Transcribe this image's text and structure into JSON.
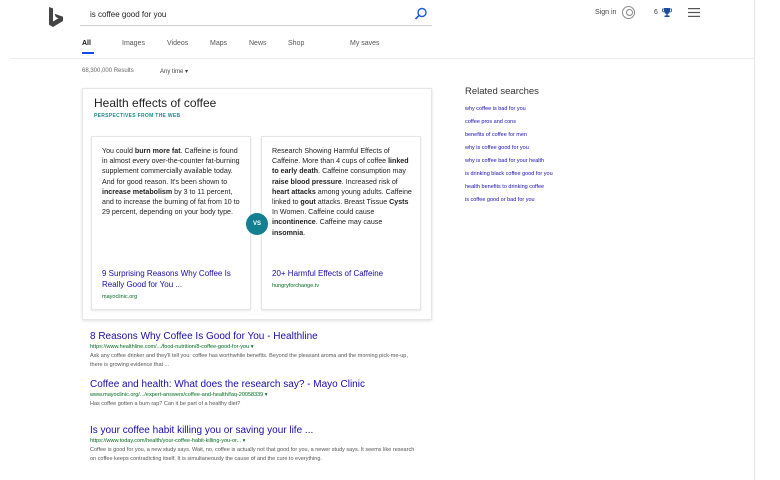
{
  "search": {
    "query": "is coffee good for you"
  },
  "header": {
    "sign_in": "Sign in",
    "rewards_count": "6"
  },
  "nav": {
    "tabs": [
      {
        "label": "All",
        "active": true
      },
      {
        "label": "Images"
      },
      {
        "label": "Videos"
      },
      {
        "label": "Maps"
      },
      {
        "label": "News"
      },
      {
        "label": "Shop"
      },
      {
        "label": "My saves"
      }
    ]
  },
  "results_meta": {
    "count": "68,300,000 Results",
    "time_filter": "Any time ▾"
  },
  "answer_card": {
    "title": "Health effects of coffee",
    "subtitle": "PERSPECTIVES FROM THE WEB",
    "vs": "VS",
    "left": {
      "text_html": "You could <b>burn more fat</b>. Caffeine is found in almost every over-the-counter fat-burning supplement commercially available today. And for good reason. It's been shown to <b>increase metabolism</b> by 3 to 11 percent, and to increase the burning of fat from 10 to 29 percent, depending on your body type.",
      "link": "9 Surprising Reasons Why Coffee Is Really Good for You ...",
      "domain": "mayoclinic.org"
    },
    "right": {
      "text_html": "Research Showing Harmful Effects of Caffeine. More than 4 cups of coffee <b>linked to early death</b>. Caffeine consumption may <b>raise blood pressure</b>. Increased risk of <b>heart attacks</b> among young adults. Caffeine linked to <b>gout</b> attacks. Breast Tissue <b>Cysts</b> In Women. Caffeine could cause <b>incontinence</b>. Caffeine may cause <b>insomnia</b>.",
      "link": "20+ Harmful Effects of Caffeine",
      "domain": "hungryforchange.tv"
    }
  },
  "related": {
    "title": "Related searches",
    "items": [
      "why coffee is bad for you",
      "coffee pros and cons",
      "benefits of coffee for men",
      "why is coffee good for you",
      "why is coffee bad for your health",
      "is drinking black coffee good for you",
      "health benefits to drinking coffee",
      "is coffee good or bad for you"
    ]
  },
  "results": [
    {
      "title": "8 Reasons Why Coffee Is Good for You - Healthline",
      "url": "https://www.healthline.com/.../food-nutrition/8-coffee-good-for-you ▾",
      "snippet": "Ask any coffee drinker and they'll tell you: coffee has worthwhile benefits. Beyond the pleasant aroma and the morning pick-me-up, there is growing evidence that ..."
    },
    {
      "title": "Coffee and health: What does the research say? - Mayo Clinic",
      "url": "www.mayoclinic.org/.../expert-answers/coffee-and-health/faq-20058339 ▾",
      "snippet": "Has coffee gotten a bum rap? Can it be part of a healthy diet?"
    },
    {
      "title": "Is your coffee habit killing you or saving your life ...",
      "url": "https://www.today.com/health/your-coffee-habit-killing-you-or... ▾",
      "snippet": "Coffee is good for you, a new study says. Wait, no, coffee is actually not that good for you, a newer study says. It seems like research on coffee keeps contradicting itself. It is simultaneously the cause of and the cure to everything."
    }
  ]
}
